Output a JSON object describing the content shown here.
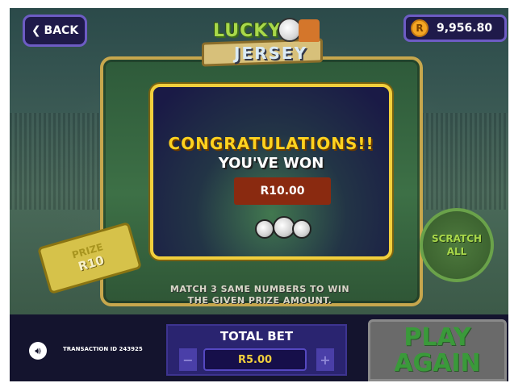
{
  "header": {
    "back_label": "BACK",
    "logo_line1": "LUCKY",
    "logo_line2": "JERSEY",
    "balance_currency": "R",
    "balance_amount": "9,956.80"
  },
  "modal": {
    "congrats": "CONGRATULATIONS!!",
    "won": "YOU'VE WON",
    "prize_amount": "R10.00"
  },
  "board": {
    "prize_label": "PRIZE",
    "prize_value": "R10",
    "scratch_line1": "SCRATCH",
    "scratch_line2": "ALL",
    "instructions_line1": "MATCH 3 SAME NUMBERS TO WIN",
    "instructions_line2": "THE GIVEN PRIZE AMOUNT."
  },
  "footer": {
    "transaction": "TRANSACTION ID 243925",
    "total_bet_title": "TOTAL BET",
    "total_bet_value": "R5.00",
    "minus": "−",
    "plus": "+",
    "play_line1": "PLAY",
    "play_line2": "AGAIN"
  },
  "colors": {
    "accent_gold": "#f1cf3c",
    "panel_purple": "#2a2470",
    "play_green": "#3a9a3a",
    "prize_red": "#8a2a10"
  }
}
